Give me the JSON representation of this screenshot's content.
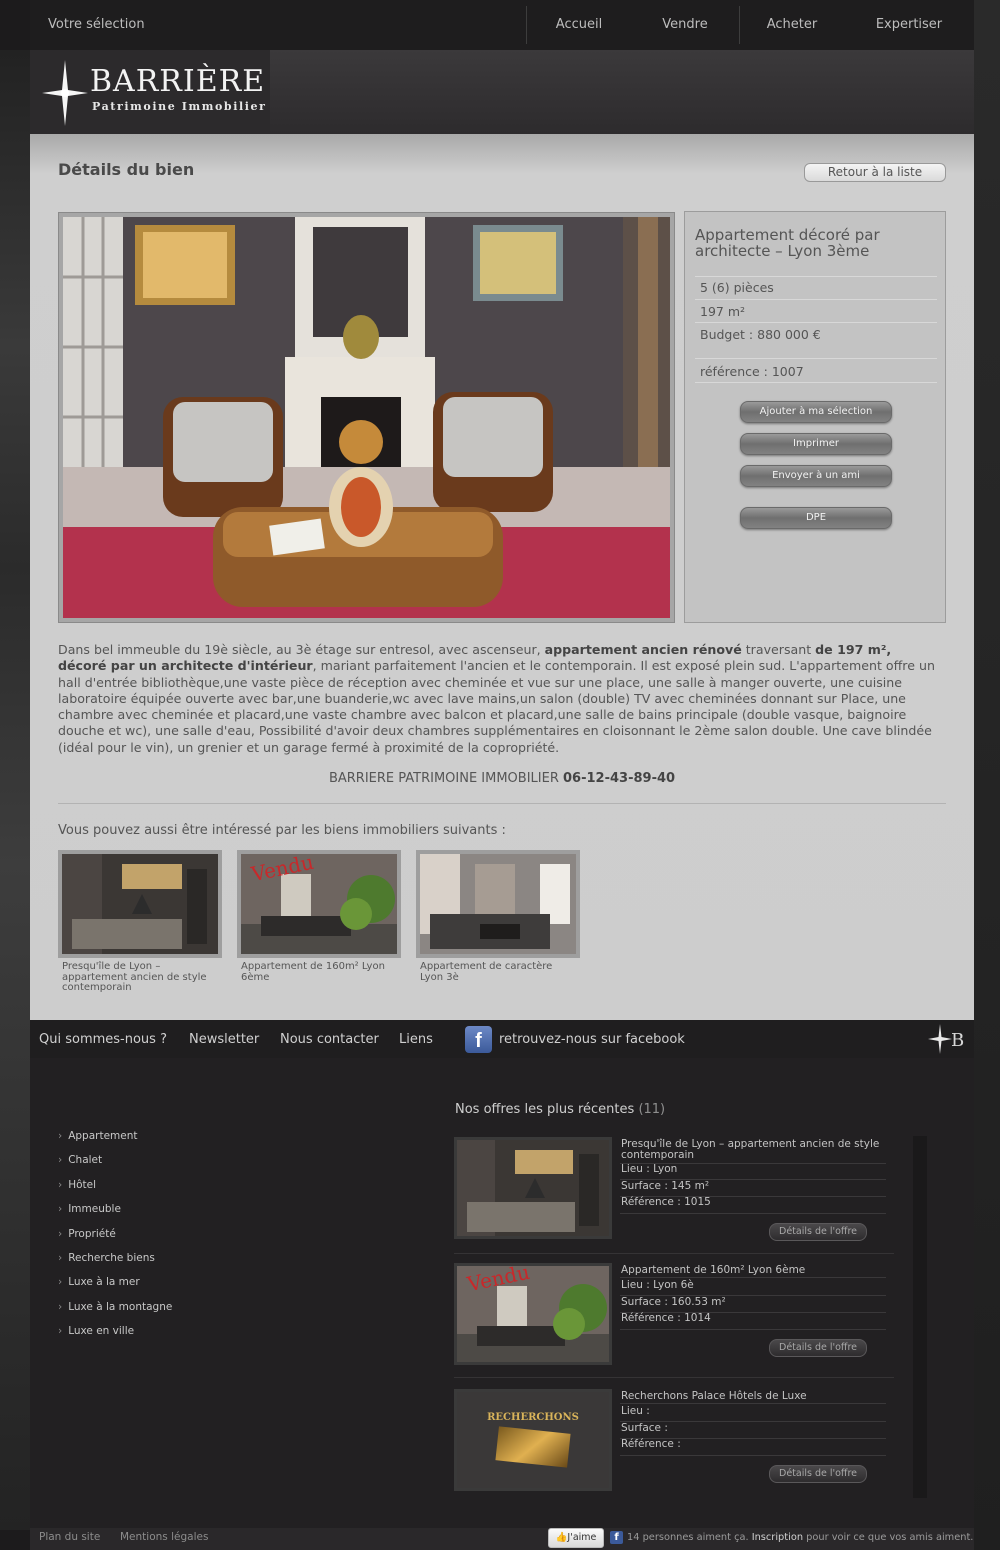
{
  "top_bar": {
    "selection_label": "Votre sélection",
    "nav": [
      "Accueil",
      "Vendre",
      "Acheter",
      "Expertiser"
    ]
  },
  "logo": {
    "title": "BARRIÈRE",
    "subtitle": "Patrimoine Immobilier"
  },
  "page": {
    "title": "Détails du bien",
    "back_label": "Retour à la liste"
  },
  "property": {
    "title": "Appartement décoré par architecte – Lyon 3ème",
    "rooms": "5 (6) pièces",
    "surface": "197 m²",
    "budget": "Budget : 880 000 €",
    "reference": "référence : 1007",
    "actions": [
      "Ajouter à ma sélection",
      "Imprimer",
      "Envoyer à un ami",
      "DPE"
    ]
  },
  "description": {
    "p1": "Dans bel immeuble du 19è siècle, au 3è étage sur entresol, avec ascenseur, ",
    "b1": "appartement ancien rénové",
    "p2": " traversant ",
    "b2": "de 197 m²,",
    "b3": "décoré par un architecte d'intérieur",
    "p3": ", mariant parfaitement l'ancien et le contemporain. Il est exposé plein sud. L'appartement offre un hall d'entrée bibliothèque,une vaste pièce de réception avec cheminée et vue sur une place, une salle à manger ouverte, une cuisine laboratoire équipée ouverte avec bar,une buanderie,wc avec lave mains,un salon (double) TV avec cheminées donnant sur Place, une chambre avec cheminée et placard,une vaste chambre avec balcon et placard,une salle de bains principale (double vasque, baignoire douche et wc), une salle d'eau, Possibilité d'avoir deux chambres supplémentaires en cloisonnant le 2ème salon double. Une cave blindée (idéal pour le vin), un grenier et un garage fermé à proximité de la copropriété.",
    "contact_name": "BARRIERE PATRIMOINE IMMOBILIER ",
    "contact_phone": "06-12-43-89-40"
  },
  "related": {
    "heading": "Vous pouvez aussi être intéressé par les biens immobiliers suivants :",
    "items": [
      {
        "caption": "Presqu'île de Lyon – appartement ancien de style contemporain",
        "sold": ""
      },
      {
        "caption": "Appartement de 160m² Lyon 6ème",
        "sold": "Vendu"
      },
      {
        "caption": "Appartement de caractère Lyon 3è",
        "sold": ""
      }
    ]
  },
  "footer_nav": {
    "links": [
      "Qui sommes-nous ?",
      "Newsletter",
      "Nous contacter",
      "Liens"
    ],
    "facebook": "retrouvez-nous sur facebook"
  },
  "categories": [
    "Appartement",
    "Chalet",
    "Hôtel",
    "Immeuble",
    "Propriété",
    "Recherche biens",
    "Luxe à la mer",
    "Luxe à la montagne",
    "Luxe en ville"
  ],
  "recent": {
    "title": "Nos offres les plus récentes",
    "count": "(11)",
    "button_label": "Détails de l'offre",
    "offers": [
      {
        "title": "Presqu'île de Lyon – appartement ancien de style contemporain",
        "lieu": "Lieu : Lyon",
        "surface": "Surface : 145 m²",
        "reference": "Référence : 1015",
        "sold": ""
      },
      {
        "title": "Appartement de 160m² Lyon 6ème",
        "lieu": "Lieu : Lyon 6è",
        "surface": "Surface : 160.53 m²",
        "reference": "Référence : 1014",
        "sold": "Vendu"
      },
      {
        "title": "Recherchons Palace Hôtels de Luxe",
        "lieu": "Lieu :",
        "surface": "Surface :",
        "reference": "Référence :",
        "sold": "",
        "image_text": "RECHERCHONS"
      }
    ]
  },
  "bottom": {
    "links": [
      "Plan du site",
      "Mentions légales"
    ],
    "like_label": "J'aime",
    "like_count_text": "14 personnes aiment ça. ",
    "inscription": "Inscription",
    "like_tail": " pour voir ce que vos amis aiment."
  },
  "colors": {
    "accent_sold": "#c8282a",
    "facebook": "#3b5a9a",
    "panel": "#cdcdcd",
    "dark": "#222022"
  }
}
